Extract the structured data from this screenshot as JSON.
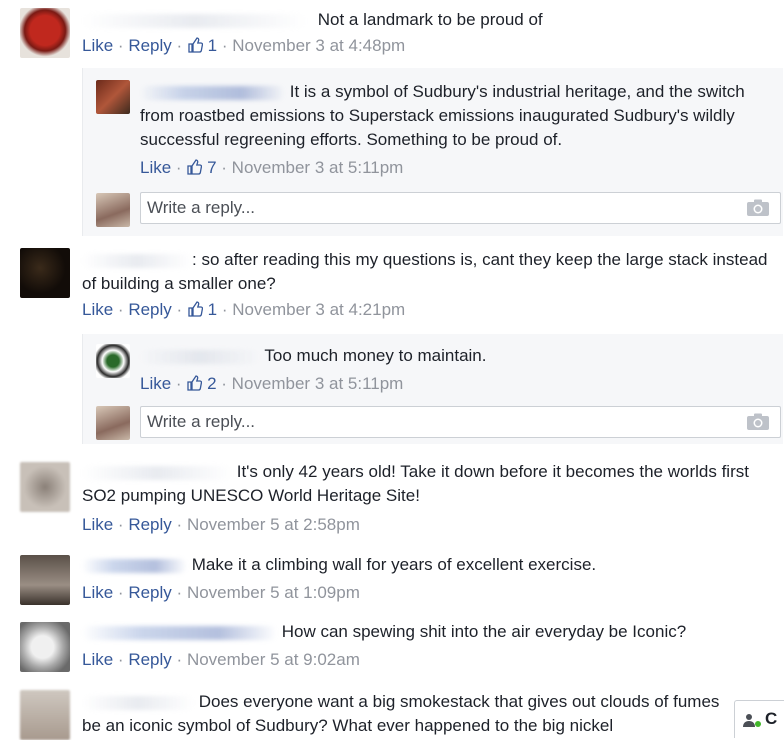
{
  "actions": {
    "like": "Like",
    "reply": "Reply",
    "sep": "·",
    "write_reply_placeholder": "Write a reply..."
  },
  "comments": [
    {
      "text": "Not a landmark to be proud of",
      "likes": "1",
      "time": "November 3 at 4:48pm"
    },
    {
      "text": "It is a symbol of Sudbury's industrial heritage, and the switch from roastbed emissions to Superstack emissions inaugurated Sudbury's wildly successful regreening efforts. Something to be proud of.",
      "likes": "7",
      "time": "November 3 at 5:11pm"
    },
    {
      "text": ": so after reading this my questions is, cant they keep the large stack instead of building a smaller one?",
      "likes": "1",
      "time": "November 3 at 4:21pm"
    },
    {
      "text": "Too much money to maintain.",
      "likes": "2",
      "time": "November 3 at 5:11pm"
    },
    {
      "text": "It's only 42 years old! Take it down before it becomes the worlds first SO2 pumping UNESCO World Heritage Site!",
      "time": "November 5 at 2:58pm"
    },
    {
      "text": "Make it a climbing wall for years of excellent exercise.",
      "time": "November 5 at 1:09pm"
    },
    {
      "text": "How can spewing shit into the air everyday be Iconic?",
      "time": "November 5 at 9:02am"
    },
    {
      "text": "Does everyone want a big smokestack that gives out clouds of fumes be an iconic symbol of Sudbury? What ever happened to the big nickel"
    }
  ],
  "chat": {
    "label": "C"
  },
  "colors": {
    "link": "#365899",
    "meta": "#90949c",
    "text": "#1d2129",
    "panel": "#f6f7f9",
    "online": "#42b72a"
  }
}
